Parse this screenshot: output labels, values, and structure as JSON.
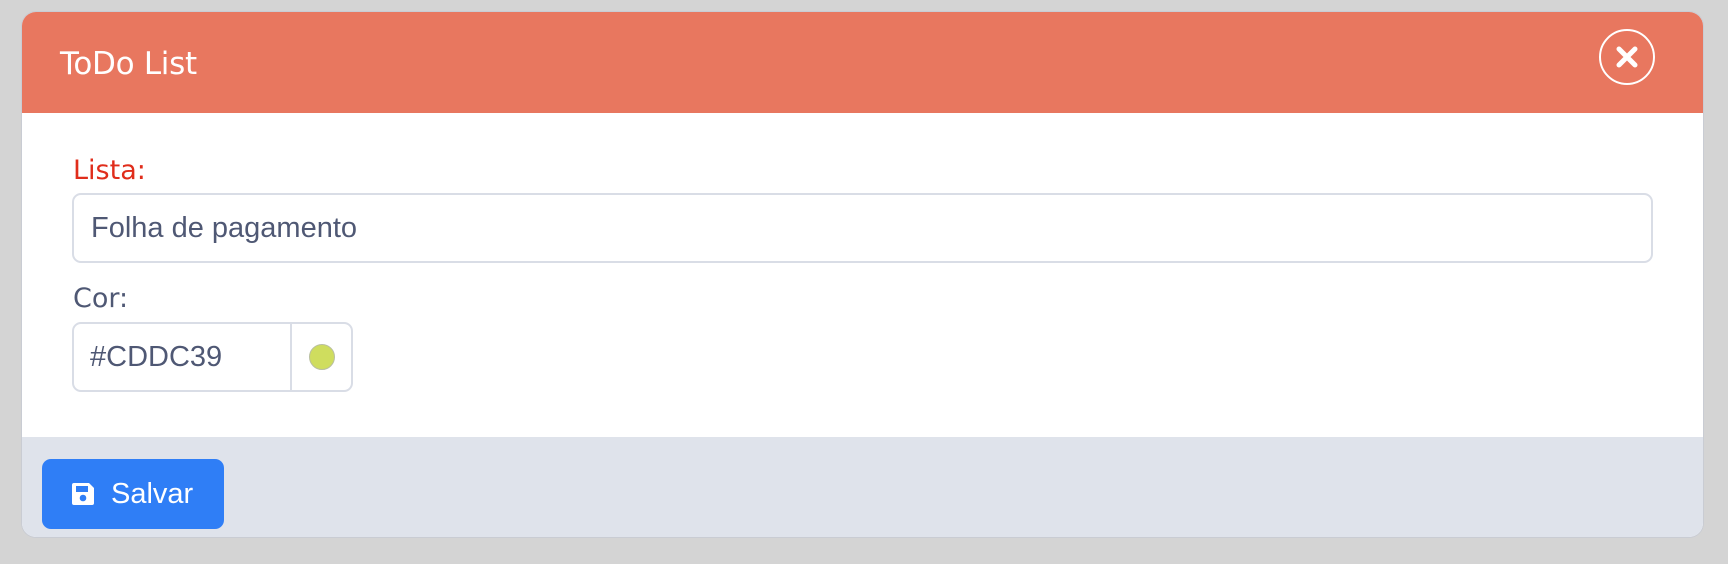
{
  "dialog": {
    "title": "ToDo List"
  },
  "form": {
    "list_label": "Lista:",
    "list_value": "Folha de pagamento",
    "color_label": "Cor:",
    "color_value": "#CDDC39"
  },
  "footer": {
    "save_label": "Salvar"
  },
  "icons": {
    "close": "close-icon",
    "save": "floppy-disk-icon"
  },
  "colors": {
    "header": "#e8775f",
    "required_label": "#e02d1b",
    "primary": "#2f7ef6",
    "swatch": "#CDDC39"
  }
}
